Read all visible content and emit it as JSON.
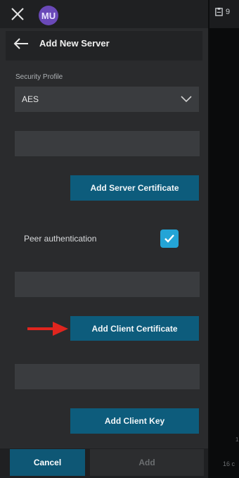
{
  "topbar": {
    "avatar_initials": "MU",
    "right_badge_count": "9"
  },
  "header": {
    "title": "Add New Server"
  },
  "form": {
    "security_profile_label": "Security Profile",
    "security_profile_value": "AES",
    "server_cert_field_value": "",
    "add_server_certificate_label": "Add Server Certificate",
    "peer_authentication_label": "Peer authentication",
    "peer_authentication_checked": true,
    "client_cert_field_value": "",
    "add_client_certificate_label": "Add Client Certificate",
    "client_key_field_value": "",
    "add_client_key_label": "Add Client Key"
  },
  "footer": {
    "cancel_label": "Cancel",
    "add_label": "Add"
  },
  "background_panel": {
    "bottom_text": "16 c",
    "side_mark": "1"
  },
  "colors": {
    "primary_button": "#0d5c7c",
    "checkbox": "#23a4d6",
    "avatar": "#6a49b8",
    "arrow": "#e0251e"
  },
  "icons": {
    "close": "close-icon",
    "back": "back-arrow-icon",
    "dropdown": "chevron-down-icon",
    "check": "checkmark-icon",
    "annotation": "red-arrow-icon"
  }
}
